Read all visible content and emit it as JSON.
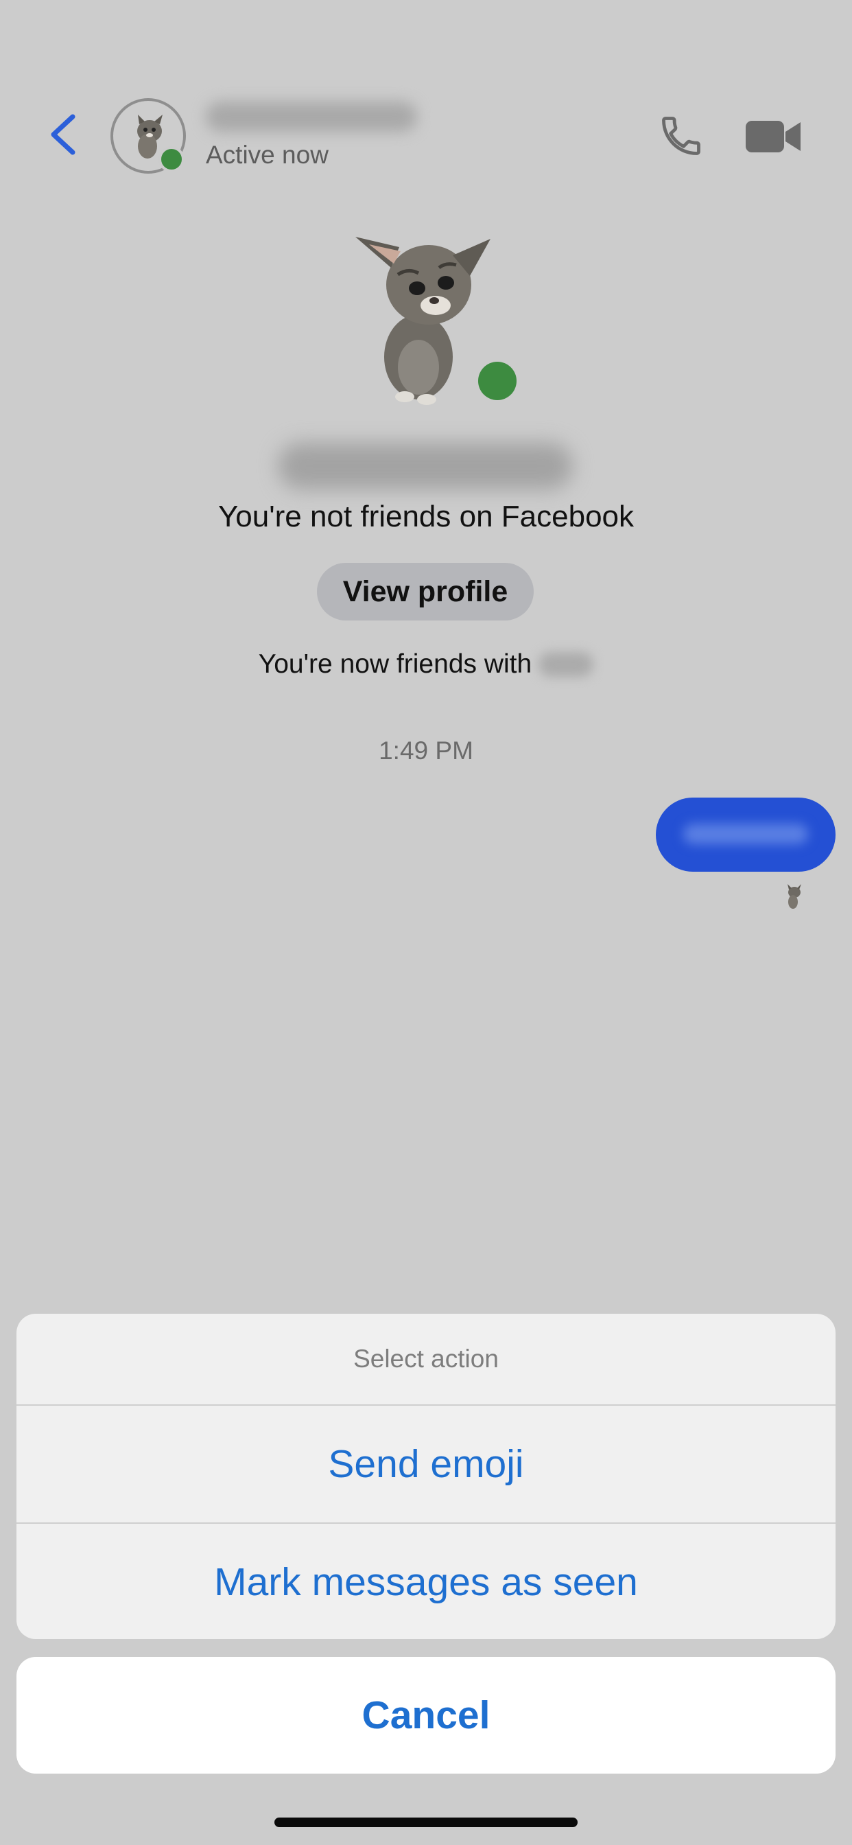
{
  "header": {
    "back_icon": "chevron-left-icon",
    "status": "Active now",
    "call_icon": "phone-icon",
    "video_icon": "video-camera-icon"
  },
  "profile": {
    "relationship_text": "You're not friends on Facebook",
    "view_profile_label": "View profile",
    "friends_notice": "You're now friends with"
  },
  "conversation": {
    "timestamp": "1:49 PM"
  },
  "action_sheet": {
    "title": "Select action",
    "options": [
      {
        "label": "Send emoji"
      },
      {
        "label": "Mark messages as seen"
      }
    ],
    "cancel_label": "Cancel"
  },
  "colors": {
    "background_dim": "#cccccc",
    "accent_blue": "#1e6fd0",
    "message_bubble": "#2450d4",
    "online_green": "#3d8b40",
    "back_chevron": "#2b5fd9"
  }
}
